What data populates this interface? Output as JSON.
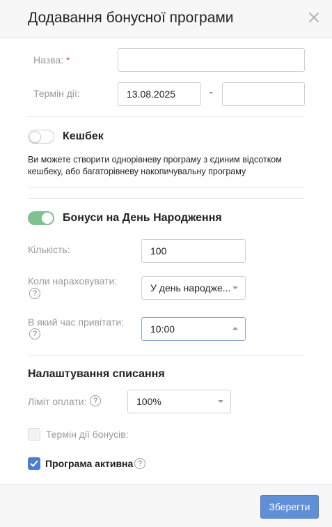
{
  "dialog": {
    "title": "Додавання бонусної програми",
    "close_icon": "close-icon"
  },
  "form": {
    "name_label": "Назва:",
    "required_mark": "*",
    "name_value": "",
    "term_label": "Термін дії:",
    "date_from": "13.08.2025",
    "date_separator": "-",
    "date_to": ""
  },
  "cashback": {
    "title": "Кешбек",
    "enabled": false,
    "description": "Ви можете створити однорівневу програму з єдиним відсотком кешбеку, або багаторівневу накопичувальну програму"
  },
  "birthday": {
    "title": "Бонуси на День Народження",
    "enabled": true,
    "amount_label": "Кількість:",
    "amount_value": "100",
    "when_label": "Коли нараховувати:",
    "when_value": "У день народже...",
    "time_label": "В який час привітати:",
    "time_value": "10:00",
    "help_icon_text": "?"
  },
  "writeoff": {
    "title": "Налаштування списання",
    "limit_label": "Ліміт оплати:",
    "limit_value": "100%",
    "bonus_term_label": "Термін дії бонусів:",
    "bonus_term_checked": false,
    "active_label": "Програма активна",
    "active_checked": true
  },
  "footer": {
    "save_label": "Зберегти"
  },
  "colors": {
    "accent": "#5f8fd6",
    "toggle_on": "#7fc190",
    "required": "#e04b3a"
  }
}
